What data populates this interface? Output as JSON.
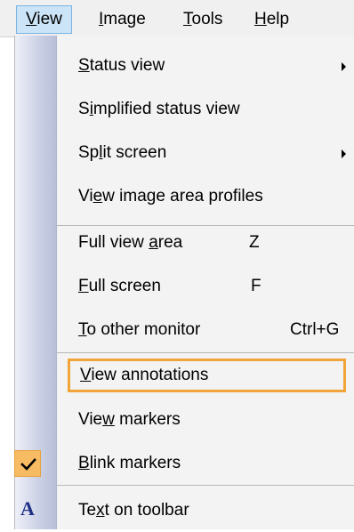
{
  "menubar": {
    "items": [
      {
        "pre": "",
        "key": "V",
        "post": "iew",
        "active": true
      },
      {
        "pre": "",
        "key": "I",
        "post": "mage",
        "active": false
      },
      {
        "pre": "",
        "key": "T",
        "post": "ools",
        "active": false
      },
      {
        "pre": "",
        "key": "H",
        "post": "elp",
        "active": false
      }
    ]
  },
  "view_menu": {
    "status_view": {
      "pre": "",
      "key": "S",
      "post": "tatus view"
    },
    "simplified_status_view": {
      "pre": "S",
      "key": "i",
      "post": "mplified status view"
    },
    "split_screen": {
      "pre": "Sp",
      "key": "l",
      "post": "it screen"
    },
    "view_image_area_profiles": {
      "pre": "Vi",
      "key": "e",
      "post": "w image area profiles"
    },
    "full_view_area": {
      "pre": "Full view ",
      "key": "a",
      "post": "rea",
      "shortcut": "Z"
    },
    "full_screen": {
      "pre": "",
      "key": "F",
      "post": "ull screen",
      "shortcut": "F"
    },
    "to_other_monitor": {
      "pre": "",
      "key": "T",
      "post": "o other monitor",
      "shortcut": "Ctrl+G"
    },
    "view_annotations": {
      "pre": "",
      "key": "V",
      "post": "iew annotations"
    },
    "view_markers": {
      "pre": "Vie",
      "key": "w",
      "post": " markers"
    },
    "blink_markers": {
      "pre": "",
      "key": "B",
      "post": "link markers",
      "checked": true
    },
    "text_on_toolbar": {
      "pre": "Te",
      "key": "x",
      "post": "t on toolbar",
      "icon": "A"
    }
  },
  "colors": {
    "highlight_border": "#f0a43a",
    "check_bg": "#f7bc63",
    "icon_blue": "#1f2f86"
  }
}
